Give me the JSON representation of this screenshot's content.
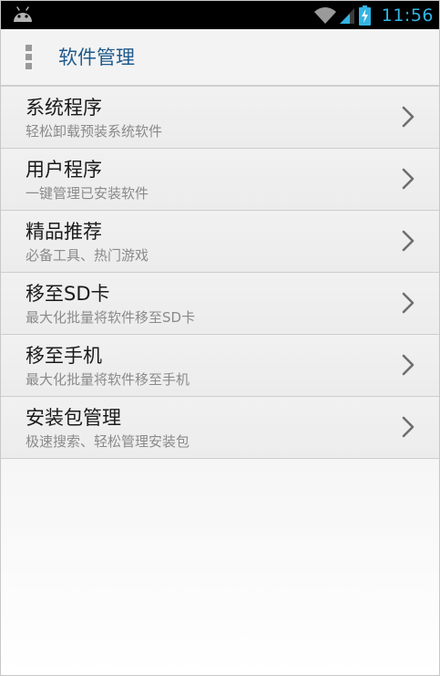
{
  "status_bar": {
    "time": "11:56",
    "icons": [
      "android-icon",
      "wifi-icon",
      "signal-icon",
      "battery-charging-icon"
    ],
    "accent_color": "#33b5e5"
  },
  "action_bar": {
    "title": "软件管理",
    "menu_icon": "overflow-menu-icon",
    "title_color": "#1e5a8c"
  },
  "list": {
    "items": [
      {
        "title": "系统程序",
        "subtitle": "轻松卸载预装系统软件",
        "icon": "chevron-right-icon"
      },
      {
        "title": "用户程序",
        "subtitle": "一键管理已安装软件",
        "icon": "chevron-right-icon"
      },
      {
        "title": "精品推荐",
        "subtitle": "必备工具、热门游戏",
        "icon": "chevron-right-icon"
      },
      {
        "title": "移至SD卡",
        "subtitle": "最大化批量将软件移至SD卡",
        "icon": "chevron-right-icon"
      },
      {
        "title": "移至手机",
        "subtitle": "最大化批量将软件移至手机",
        "icon": "chevron-right-icon"
      },
      {
        "title": "安装包管理",
        "subtitle": "极速搜索、轻松管理安装包",
        "icon": "chevron-right-icon"
      }
    ]
  }
}
